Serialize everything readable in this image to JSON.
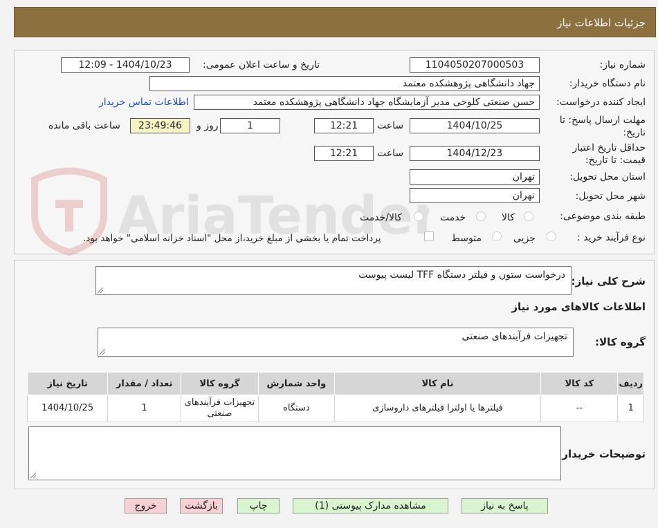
{
  "header": {
    "title": "جزئیات اطلاعات نیاز"
  },
  "form": {
    "need_number_label": "شماره نیاز:",
    "need_number": "1104050207000503",
    "announce_label": "تاریخ و ساعت اعلان عمومی:",
    "announce_value": "1404/10/23 - 12:09",
    "buyer_org_label": "نام دستگاه خریدار:",
    "buyer_org": "جهاد دانشگاهی پژوهشکده معتمد",
    "creator_label": "ایجاد کننده درخواست:",
    "creator": "حسن صنعتی کلوخی مدیر آزمایشگاه جهاد دانشگاهی پژوهشکده معتمد",
    "contact_link": "اطلاعات تماس خریدار",
    "deadline_label": "مهلت ارسال پاسخ: تا تاریخ:",
    "deadline_date": "1404/10/25",
    "time_word": "ساعت",
    "deadline_time": "12:21",
    "days_value": "1",
    "days_word": "روز و",
    "remaining_time": "23:49:46",
    "remaining_word": "ساعت باقی مانده",
    "validity_label": "حداقل تاریخ اعتبار قیمت: تا تاریخ:",
    "validity_date": "1404/12/23",
    "validity_time": "12:21",
    "province_label": "استان محل تحویل:",
    "province": "تهران",
    "city_label": "شهر محل تحویل:",
    "city": "تهران",
    "category_label": "طبقه بندی موضوعی:",
    "category_options": [
      "کالا",
      "خدمت",
      "کالا/خدمت"
    ],
    "process_label": "نوع فرآیند خرید :",
    "process_options": [
      "جزیی",
      "متوسط"
    ],
    "payment_note": "پرداخت تمام یا بخشی از مبلغ خرید،از محل \"اسناد خزانه اسلامی\" خواهد بود."
  },
  "details": {
    "summary_label": "شرح کلی نیاز:",
    "summary_text": "درخواست ستون و فیلتر دستگاه TFF لیست پیوست",
    "goods_info_title": "اطلاعات کالاهای مورد نیاز",
    "goods_group_label": "گروه کالا:",
    "goods_group_text": "تجهیزات فرآیندهای صنعتی",
    "table_headers": [
      "ردیف",
      "کد کالا",
      "نام کالا",
      "واحد شمارش",
      "گروه کالا",
      "تعداد / مقدار",
      "تاریخ نیاز"
    ],
    "rows": [
      [
        "1",
        "--",
        "فیلترها یا اولترا فیلترهای داروسازی",
        "دستگاه",
        "تجهیزات فرآیندهای صنعتی",
        "1",
        "1404/10/25"
      ]
    ],
    "buyer_notes_label": "توضیحات خریدار:",
    "buyer_notes_text": ""
  },
  "buttons": {
    "reply": "پاسخ به نیاز",
    "attachments": "مشاهده مدارک پیوستی (1)",
    "print": "چاپ",
    "back": "بازگشت",
    "exit": "خروج"
  },
  "watermark": {
    "text": "AriaTender.neT"
  },
  "colors": {
    "header": "#8d7040",
    "link": "#1a49c9",
    "yellow": "#f7f3c5",
    "green_btn": "#d9f5d0",
    "pink_btn": "#f6d0d4"
  }
}
